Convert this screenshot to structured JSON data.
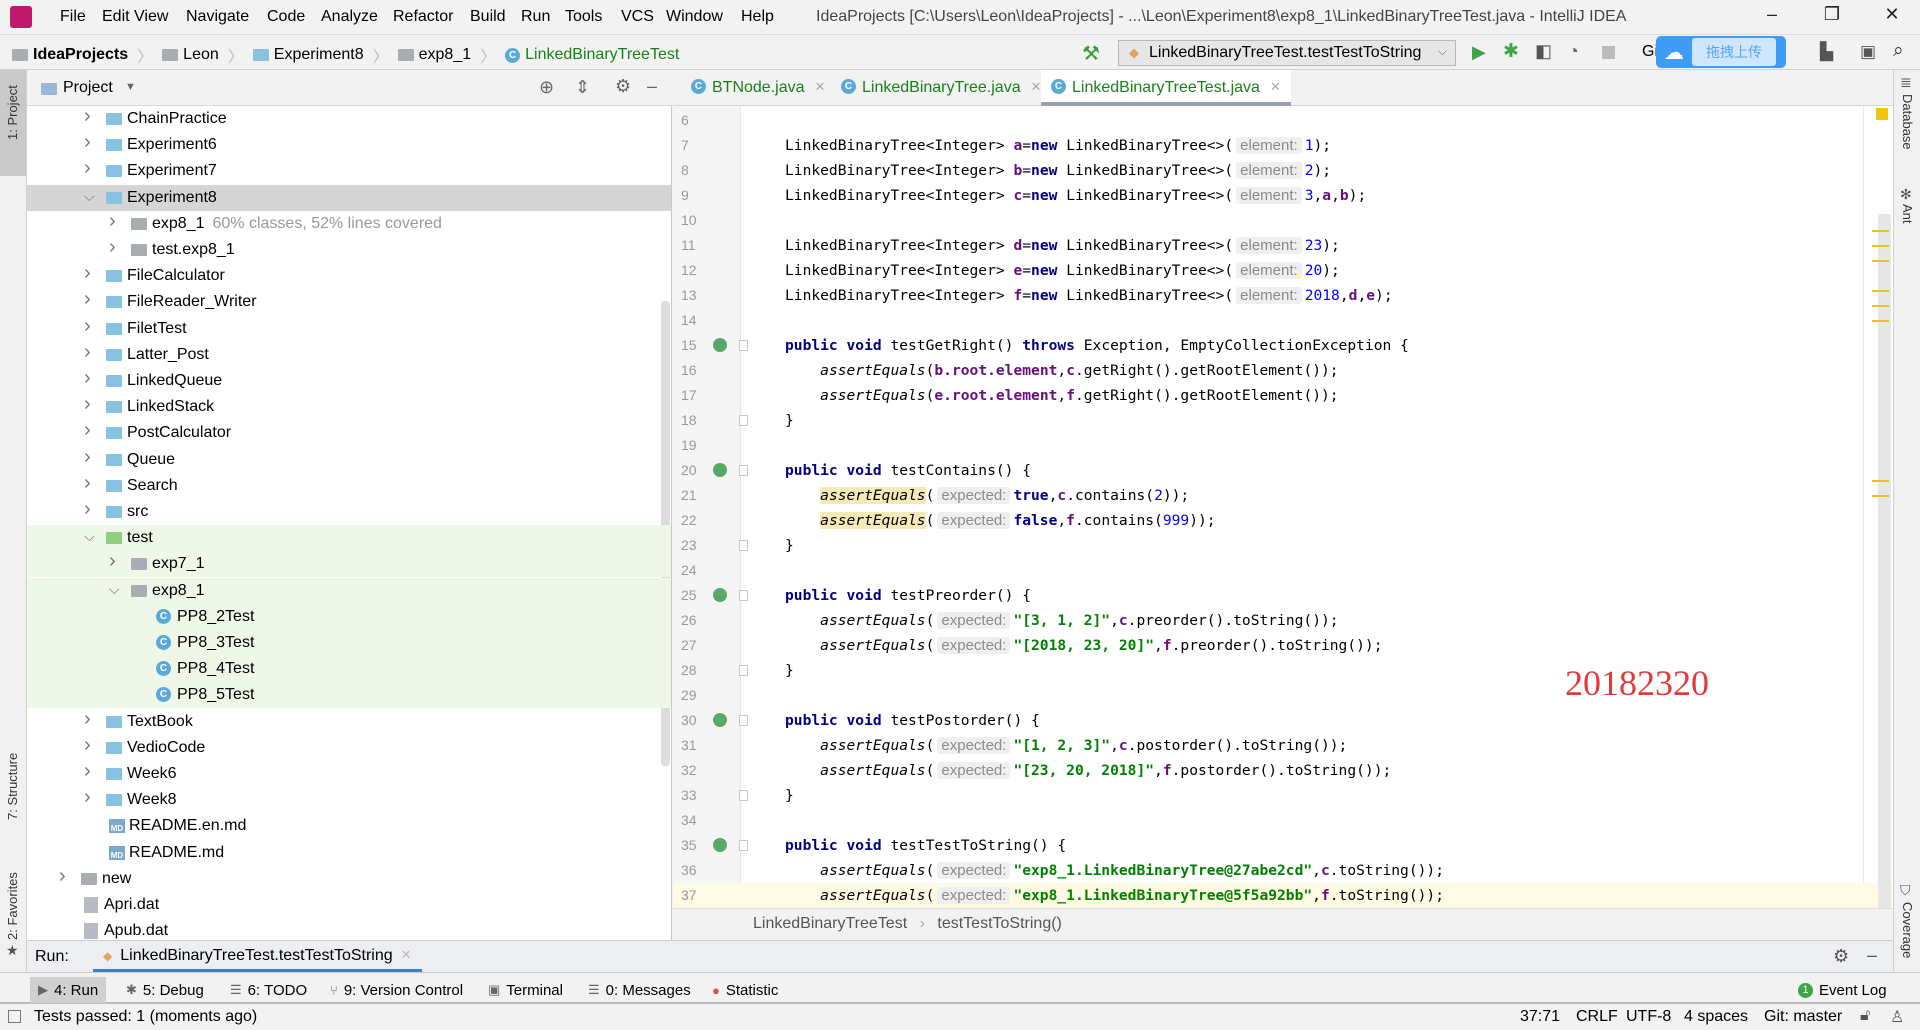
{
  "app": {
    "title": "IdeaProjects [C:\\Users\\Leon\\IdeaProjects] - ...\\Leon\\Experiment8\\exp8_1\\LinkedBinaryTreeTest.java - IntelliJ IDEA",
    "menu": [
      "File",
      "Edit",
      "View",
      "Navigate",
      "Code",
      "Analyze",
      "Refactor",
      "Build",
      "Run",
      "Tools",
      "VCS",
      "Window",
      "Help"
    ],
    "window_buttons": {
      "minimize": "–",
      "maximize": "❐",
      "close": "✕"
    }
  },
  "navbar": {
    "crumbs": [
      "IdeaProjects",
      "Leon",
      "Experiment8",
      "exp8_1",
      "LinkedBinaryTreeTest"
    ],
    "run_config": "LinkedBinaryTreeTest.testTestToString",
    "git_label": "Gi",
    "upload_label": "拖拽上传"
  },
  "left_strip": {
    "project": "1: Project",
    "structure": "7: Structure",
    "favorites": "2: Favorites"
  },
  "right_strip": {
    "database": "Database",
    "ant": "Ant",
    "coverage": "Coverage"
  },
  "project": {
    "title": "Project",
    "tree": [
      {
        "label": "ChainPractice",
        "depth": 1,
        "arrow": "right",
        "icon": "folder"
      },
      {
        "label": "Experiment6",
        "depth": 1,
        "arrow": "right",
        "icon": "folder"
      },
      {
        "label": "Experiment7",
        "depth": 1,
        "arrow": "right",
        "icon": "folder"
      },
      {
        "label": "Experiment8",
        "depth": 1,
        "arrow": "down",
        "icon": "folder",
        "selected": true
      },
      {
        "label": "exp8_1",
        "depth": 2,
        "arrow": "right",
        "icon": "package",
        "note": "60% classes, 52% lines covered"
      },
      {
        "label": "test.exp8_1",
        "depth": 2,
        "arrow": "right",
        "icon": "package"
      },
      {
        "label": "FileCalculator",
        "depth": 1,
        "arrow": "right",
        "icon": "folder"
      },
      {
        "label": "FileReader_Writer",
        "depth": 1,
        "arrow": "right",
        "icon": "folder"
      },
      {
        "label": "FiletTest",
        "depth": 1,
        "arrow": "right",
        "icon": "folder"
      },
      {
        "label": "Latter_Post",
        "depth": 1,
        "arrow": "right",
        "icon": "folder"
      },
      {
        "label": "LinkedQueue",
        "depth": 1,
        "arrow": "right",
        "icon": "folder"
      },
      {
        "label": "LinkedStack",
        "depth": 1,
        "arrow": "right",
        "icon": "folder"
      },
      {
        "label": "PostCalculator",
        "depth": 1,
        "arrow": "right",
        "icon": "folder"
      },
      {
        "label": "Queue",
        "depth": 1,
        "arrow": "right",
        "icon": "folder"
      },
      {
        "label": "Search",
        "depth": 1,
        "arrow": "right",
        "icon": "folder"
      },
      {
        "label": "src",
        "depth": 1,
        "arrow": "right",
        "icon": "folder"
      },
      {
        "label": "test",
        "depth": 1,
        "arrow": "down",
        "icon": "test-folder",
        "test": true
      },
      {
        "label": "exp7_1",
        "depth": 2,
        "arrow": "right",
        "icon": "package",
        "test": true
      },
      {
        "label": "exp8_1",
        "depth": 2,
        "arrow": "down",
        "icon": "package",
        "test": true
      },
      {
        "label": "PP8_2Test",
        "depth": 3,
        "icon": "class",
        "test": true
      },
      {
        "label": "PP8_3Test",
        "depth": 3,
        "icon": "class",
        "test": true
      },
      {
        "label": "PP8_4Test",
        "depth": 3,
        "icon": "class",
        "test": true
      },
      {
        "label": "PP8_5Test",
        "depth": 3,
        "icon": "class",
        "test": true
      },
      {
        "label": "TextBook",
        "depth": 1,
        "arrow": "right",
        "icon": "folder"
      },
      {
        "label": "VedioCode",
        "depth": 1,
        "arrow": "right",
        "icon": "folder"
      },
      {
        "label": "Week6",
        "depth": 1,
        "arrow": "right",
        "icon": "folder"
      },
      {
        "label": "Week8",
        "depth": 1,
        "arrow": "right",
        "icon": "folder"
      },
      {
        "label": "README.en.md",
        "depth": 2,
        "icon": "markdown"
      },
      {
        "label": "README.md",
        "depth": 2,
        "icon": "markdown"
      },
      {
        "label": "new",
        "depth": 0,
        "arrow": "right",
        "icon": "gray-folder"
      },
      {
        "label": "Apri.dat",
        "depth": 1,
        "icon": "file"
      },
      {
        "label": "Apub.dat",
        "depth": 1,
        "icon": "file"
      }
    ]
  },
  "editor": {
    "tabs": [
      {
        "label": "BTNode.java"
      },
      {
        "label": "LinkedBinaryTree.java"
      },
      {
        "label": "LinkedBinaryTreeTest.java",
        "active": true
      }
    ],
    "breadcrumb": [
      "LinkedBinaryTreeTest",
      "testTestToString()"
    ],
    "current_line": 37,
    "lines": [
      {
        "n": 6,
        "t": []
      },
      {
        "n": 7,
        "t": [
          [
            "p",
            "LinkedBinaryTree<Integer> "
          ],
          [
            "var",
            "a"
          ],
          [
            "p",
            "="
          ],
          [
            "kw",
            "new"
          ],
          [
            "p",
            " LinkedBinaryTree<>("
          ],
          [
            "hint",
            "element:"
          ],
          [
            "num",
            "1"
          ],
          [
            "p",
            ");"
          ]
        ]
      },
      {
        "n": 8,
        "t": [
          [
            "p",
            "LinkedBinaryTree<Integer> "
          ],
          [
            "var",
            "b"
          ],
          [
            "p",
            "="
          ],
          [
            "kw",
            "new"
          ],
          [
            "p",
            " LinkedBinaryTree<>("
          ],
          [
            "hint",
            "element:"
          ],
          [
            "num",
            "2"
          ],
          [
            "p",
            ");"
          ]
        ]
      },
      {
        "n": 9,
        "t": [
          [
            "p",
            "LinkedBinaryTree<Integer> "
          ],
          [
            "var",
            "c"
          ],
          [
            "p",
            "="
          ],
          [
            "kw",
            "new"
          ],
          [
            "p",
            " LinkedBinaryTree<>("
          ],
          [
            "hint",
            "element:"
          ],
          [
            "num",
            "3"
          ],
          [
            "p",
            ","
          ],
          [
            "var",
            "a"
          ],
          [
            "p",
            ","
          ],
          [
            "var",
            "b"
          ],
          [
            "p",
            ");"
          ]
        ]
      },
      {
        "n": 10,
        "t": []
      },
      {
        "n": 11,
        "t": [
          [
            "p",
            "LinkedBinaryTree<Integer> "
          ],
          [
            "var",
            "d"
          ],
          [
            "p",
            "="
          ],
          [
            "kw",
            "new"
          ],
          [
            "p",
            " LinkedBinaryTree<>("
          ],
          [
            "hint",
            "element:"
          ],
          [
            "num",
            "23"
          ],
          [
            "p",
            ");"
          ]
        ]
      },
      {
        "n": 12,
        "t": [
          [
            "p",
            "LinkedBinaryTree<Integer> "
          ],
          [
            "var",
            "e"
          ],
          [
            "p",
            "="
          ],
          [
            "kw",
            "new"
          ],
          [
            "p",
            " LinkedBinaryTree<>("
          ],
          [
            "hint",
            "element:"
          ],
          [
            "num",
            "20"
          ],
          [
            "p",
            ");"
          ]
        ]
      },
      {
        "n": 13,
        "t": [
          [
            "p",
            "LinkedBinaryTree<Integer> "
          ],
          [
            "var",
            "f"
          ],
          [
            "p",
            "="
          ],
          [
            "kw",
            "new"
          ],
          [
            "p",
            " LinkedBinaryTree<>("
          ],
          [
            "hint",
            "element:"
          ],
          [
            "num",
            "2018"
          ],
          [
            "p",
            ","
          ],
          [
            "var",
            "d"
          ],
          [
            "p",
            ","
          ],
          [
            "var",
            "e"
          ],
          [
            "p",
            ");"
          ]
        ]
      },
      {
        "n": 14,
        "t": []
      },
      {
        "n": 15,
        "run": true,
        "t": [
          [
            "kw",
            "public void "
          ],
          [
            "p",
            "testGetRight() "
          ],
          [
            "kw",
            "throws "
          ],
          [
            "p",
            "Exception, EmptyCollectionException {"
          ]
        ]
      },
      {
        "n": 16,
        "t": [
          [
            "p",
            "    "
          ],
          [
            "it",
            "assertEquals"
          ],
          [
            "p",
            "("
          ],
          [
            "var",
            "b.root.element"
          ],
          [
            "p",
            ","
          ],
          [
            "var",
            "c"
          ],
          [
            "p",
            ".getRight().getRootElement());"
          ]
        ]
      },
      {
        "n": 17,
        "t": [
          [
            "p",
            "    "
          ],
          [
            "it",
            "assertEquals"
          ],
          [
            "p",
            "("
          ],
          [
            "var",
            "e.root.element"
          ],
          [
            "p",
            ","
          ],
          [
            "var",
            "f"
          ],
          [
            "p",
            ".getRight().getRootElement());"
          ]
        ]
      },
      {
        "n": 18,
        "t": [
          [
            "p",
            "}"
          ]
        ]
      },
      {
        "n": 19,
        "t": []
      },
      {
        "n": 20,
        "run": true,
        "t": [
          [
            "kw",
            "public void "
          ],
          [
            "p",
            "testContains() {"
          ]
        ]
      },
      {
        "n": 21,
        "t": [
          [
            "p",
            "    "
          ],
          [
            "itm",
            "assertEquals"
          ],
          [
            "p",
            "("
          ],
          [
            "hint",
            "expected:"
          ],
          [
            "kw",
            "true"
          ],
          [
            "p",
            ","
          ],
          [
            "var",
            "c"
          ],
          [
            "p",
            ".contains("
          ],
          [
            "num",
            "2"
          ],
          [
            "p",
            "));"
          ]
        ]
      },
      {
        "n": 22,
        "t": [
          [
            "p",
            "    "
          ],
          [
            "itm",
            "assertEquals"
          ],
          [
            "p",
            "("
          ],
          [
            "hint",
            "expected:"
          ],
          [
            "kw",
            "false"
          ],
          [
            "p",
            ","
          ],
          [
            "var",
            "f"
          ],
          [
            "p",
            ".contains("
          ],
          [
            "num",
            "999"
          ],
          [
            "p",
            "));"
          ]
        ]
      },
      {
        "n": 23,
        "t": [
          [
            "p",
            "}"
          ]
        ]
      },
      {
        "n": 24,
        "t": []
      },
      {
        "n": 25,
        "run": true,
        "t": [
          [
            "kw",
            "public void "
          ],
          [
            "p",
            "testPreorder() {"
          ]
        ]
      },
      {
        "n": 26,
        "t": [
          [
            "p",
            "    "
          ],
          [
            "it",
            "assertEquals"
          ],
          [
            "p",
            "("
          ],
          [
            "hint",
            "expected:"
          ],
          [
            "str",
            "\"[3, 1, 2]\""
          ],
          [
            "p",
            ","
          ],
          [
            "var",
            "c"
          ],
          [
            "p",
            ".preorder().toString());"
          ]
        ]
      },
      {
        "n": 27,
        "t": [
          [
            "p",
            "    "
          ],
          [
            "it",
            "assertEquals"
          ],
          [
            "p",
            "("
          ],
          [
            "hint",
            "expected:"
          ],
          [
            "str",
            "\"[2018, 23, 20]\""
          ],
          [
            "p",
            ","
          ],
          [
            "var",
            "f"
          ],
          [
            "p",
            ".preorder().toString());"
          ]
        ]
      },
      {
        "n": 28,
        "t": [
          [
            "p",
            "}"
          ]
        ]
      },
      {
        "n": 29,
        "t": []
      },
      {
        "n": 30,
        "run": true,
        "t": [
          [
            "kw",
            "public void "
          ],
          [
            "p",
            "testPostorder() {"
          ]
        ]
      },
      {
        "n": 31,
        "t": [
          [
            "p",
            "    "
          ],
          [
            "it",
            "assertEquals"
          ],
          [
            "p",
            "("
          ],
          [
            "hint",
            "expected:"
          ],
          [
            "str",
            "\"[1, 2, 3]\""
          ],
          [
            "p",
            ","
          ],
          [
            "var",
            "c"
          ],
          [
            "p",
            ".postorder().toString());"
          ]
        ]
      },
      {
        "n": 32,
        "t": [
          [
            "p",
            "    "
          ],
          [
            "it",
            "assertEquals"
          ],
          [
            "p",
            "("
          ],
          [
            "hint",
            "expected:"
          ],
          [
            "str",
            "\"[23, 20, 2018]\""
          ],
          [
            "p",
            ","
          ],
          [
            "var",
            "f"
          ],
          [
            "p",
            ".postorder().toString());"
          ]
        ]
      },
      {
        "n": 33,
        "t": [
          [
            "p",
            "}"
          ]
        ]
      },
      {
        "n": 34,
        "t": []
      },
      {
        "n": 35,
        "run": true,
        "t": [
          [
            "kw",
            "public void "
          ],
          [
            "p",
            "testTestToString() {"
          ]
        ]
      },
      {
        "n": 36,
        "t": [
          [
            "p",
            "    "
          ],
          [
            "it",
            "assertEquals"
          ],
          [
            "p",
            "("
          ],
          [
            "hint",
            "expected:"
          ],
          [
            "str",
            "\"exp8_1.LinkedBinaryTree@27abe2cd\""
          ],
          [
            "p",
            ","
          ],
          [
            "var",
            "c"
          ],
          [
            "p",
            ".toString());"
          ]
        ]
      },
      {
        "n": 37,
        "t": [
          [
            "p",
            "    "
          ],
          [
            "it",
            "assertEquals"
          ],
          [
            "p",
            "("
          ],
          [
            "hint",
            "expected:"
          ],
          [
            "str",
            "\"exp8_1.LinkedBinaryTree@5f5a92bb\""
          ],
          [
            "p",
            ","
          ],
          [
            "var",
            "f"
          ],
          [
            "p",
            ".toString());"
          ]
        ]
      }
    ],
    "watermark": "20182320"
  },
  "run": {
    "label": "Run:",
    "tab": "LinkedBinaryTreeTest.testTestToString"
  },
  "toolwindows": [
    {
      "key": "4",
      "label": "4: Run",
      "active": true,
      "icon": "run-icon"
    },
    {
      "key": "5",
      "label": "5: Debug",
      "icon": "debug-icon"
    },
    {
      "key": "6",
      "label": "6: TODO",
      "icon": "todo-icon"
    },
    {
      "key": "9",
      "label": "9: Version Control",
      "icon": "vcs-icon"
    },
    {
      "label": "Terminal",
      "icon": "terminal-icon"
    },
    {
      "key": "0",
      "label": "0: Messages",
      "icon": "messages-icon"
    },
    {
      "label": "Statistic",
      "icon": "statistic-icon"
    }
  ],
  "event_log": {
    "label": "Event Log",
    "count": "1"
  },
  "status": {
    "message": "Tests passed: 1 (moments ago)",
    "position": "37:71",
    "line_sep": "CRLF",
    "encoding": "UTF-8",
    "indent": "4 spaces",
    "vcs": "Git: master"
  },
  "colors": {
    "keyword": "#000080",
    "field": "#660e7a",
    "number": "#0000ff",
    "string": "#008000",
    "watermark": "#e23a3a",
    "current_line": "#fffae3"
  }
}
